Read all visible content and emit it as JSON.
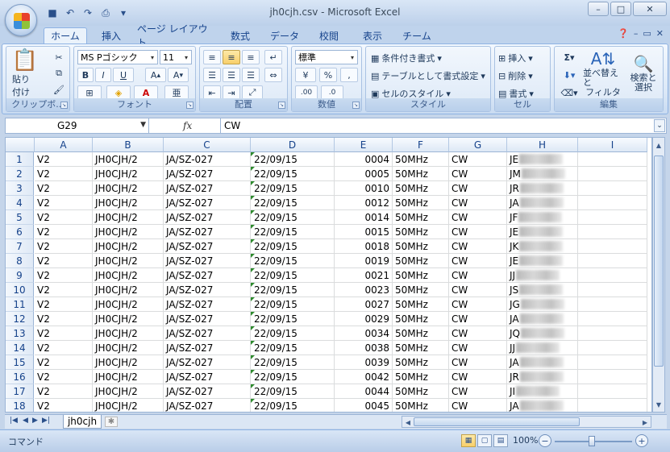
{
  "window": {
    "title": "jh0cjh.csv - Microsoft Excel"
  },
  "tabs": [
    "ホーム",
    "挿入",
    "ページ レイアウト",
    "数式",
    "データ",
    "校閲",
    "表示",
    "チーム"
  ],
  "ribbon": {
    "clipboard": {
      "label": "クリップボ...",
      "paste": "貼り付け"
    },
    "font": {
      "label": "フォント",
      "name": "MS Pゴシック",
      "size": "11"
    },
    "alignment": {
      "label": "配置"
    },
    "number": {
      "label": "数値",
      "format": "標準"
    },
    "styles": {
      "label": "スタイル",
      "conditional": "条件付き書式",
      "table": "テーブルとして書式設定",
      "cell_styles": "セルのスタイル"
    },
    "cells": {
      "label": "セル",
      "insert": "挿入",
      "delete": "削除",
      "format": "書式"
    },
    "editing": {
      "label": "編集",
      "sort_filter_line1": "並べ替えと",
      "sort_filter_line2": "フィルタ",
      "find_line1": "検索と",
      "find_line2": "選択"
    }
  },
  "formula_bar": {
    "name_box": "G29",
    "value": "CW"
  },
  "columns": [
    "A",
    "B",
    "C",
    "D",
    "E",
    "F",
    "G",
    "H",
    "I"
  ],
  "rows": [
    {
      "n": "1",
      "a": "V2",
      "b": "JH0CJH/2",
      "c": "JA/SZ-027",
      "d": "22/09/15",
      "e": "0004",
      "f": "50MHz",
      "g": "CW",
      "h": "JE"
    },
    {
      "n": "2",
      "a": "V2",
      "b": "JH0CJH/2",
      "c": "JA/SZ-027",
      "d": "22/09/15",
      "e": "0005",
      "f": "50MHz",
      "g": "CW",
      "h": "JM"
    },
    {
      "n": "3",
      "a": "V2",
      "b": "JH0CJH/2",
      "c": "JA/SZ-027",
      "d": "22/09/15",
      "e": "0010",
      "f": "50MHz",
      "g": "CW",
      "h": "JR"
    },
    {
      "n": "4",
      "a": "V2",
      "b": "JH0CJH/2",
      "c": "JA/SZ-027",
      "d": "22/09/15",
      "e": "0012",
      "f": "50MHz",
      "g": "CW",
      "h": "JA"
    },
    {
      "n": "5",
      "a": "V2",
      "b": "JH0CJH/2",
      "c": "JA/SZ-027",
      "d": "22/09/15",
      "e": "0014",
      "f": "50MHz",
      "g": "CW",
      "h": "JF"
    },
    {
      "n": "6",
      "a": "V2",
      "b": "JH0CJH/2",
      "c": "JA/SZ-027",
      "d": "22/09/15",
      "e": "0015",
      "f": "50MHz",
      "g": "CW",
      "h": "JE"
    },
    {
      "n": "7",
      "a": "V2",
      "b": "JH0CJH/2",
      "c": "JA/SZ-027",
      "d": "22/09/15",
      "e": "0018",
      "f": "50MHz",
      "g": "CW",
      "h": "JK"
    },
    {
      "n": "8",
      "a": "V2",
      "b": "JH0CJH/2",
      "c": "JA/SZ-027",
      "d": "22/09/15",
      "e": "0019",
      "f": "50MHz",
      "g": "CW",
      "h": "JE"
    },
    {
      "n": "9",
      "a": "V2",
      "b": "JH0CJH/2",
      "c": "JA/SZ-027",
      "d": "22/09/15",
      "e": "0021",
      "f": "50MHz",
      "g": "CW",
      "h": "JJ"
    },
    {
      "n": "10",
      "a": "V2",
      "b": "JH0CJH/2",
      "c": "JA/SZ-027",
      "d": "22/09/15",
      "e": "0023",
      "f": "50MHz",
      "g": "CW",
      "h": "JS"
    },
    {
      "n": "11",
      "a": "V2",
      "b": "JH0CJH/2",
      "c": "JA/SZ-027",
      "d": "22/09/15",
      "e": "0027",
      "f": "50MHz",
      "g": "CW",
      "h": "JG"
    },
    {
      "n": "12",
      "a": "V2",
      "b": "JH0CJH/2",
      "c": "JA/SZ-027",
      "d": "22/09/15",
      "e": "0029",
      "f": "50MHz",
      "g": "CW",
      "h": "JA"
    },
    {
      "n": "13",
      "a": "V2",
      "b": "JH0CJH/2",
      "c": "JA/SZ-027",
      "d": "22/09/15",
      "e": "0034",
      "f": "50MHz",
      "g": "CW",
      "h": "JQ"
    },
    {
      "n": "14",
      "a": "V2",
      "b": "JH0CJH/2",
      "c": "JA/SZ-027",
      "d": "22/09/15",
      "e": "0038",
      "f": "50MHz",
      "g": "CW",
      "h": "JJ"
    },
    {
      "n": "15",
      "a": "V2",
      "b": "JH0CJH/2",
      "c": "JA/SZ-027",
      "d": "22/09/15",
      "e": "0039",
      "f": "50MHz",
      "g": "CW",
      "h": "JA"
    },
    {
      "n": "16",
      "a": "V2",
      "b": "JH0CJH/2",
      "c": "JA/SZ-027",
      "d": "22/09/15",
      "e": "0042",
      "f": "50MHz",
      "g": "CW",
      "h": "JR"
    },
    {
      "n": "17",
      "a": "V2",
      "b": "JH0CJH/2",
      "c": "JA/SZ-027",
      "d": "22/09/15",
      "e": "0044",
      "f": "50MHz",
      "g": "CW",
      "h": "JI"
    },
    {
      "n": "18",
      "a": "V2",
      "b": "JH0CJH/2",
      "c": "JA/SZ-027",
      "d": "22/09/15",
      "e": "0045",
      "f": "50MHz",
      "g": "CW",
      "h": "JA"
    }
  ],
  "sheet_tab": "jh0cjh",
  "status": {
    "mode": "コマンド",
    "zoom": "100%"
  },
  "icons": [
    "office-button-icon",
    "save-icon",
    "undo-icon",
    "redo-icon",
    "print-icon",
    "help-icon",
    "paste-icon",
    "cut-icon",
    "copy-icon",
    "format-painter-icon",
    "bold-icon",
    "italic-icon",
    "underline-icon",
    "fill-color-icon",
    "font-color-icon",
    "sum-icon",
    "fill-icon",
    "clear-icon",
    "sort-filter-icon",
    "find-select-icon",
    "fx-icon",
    "new-sheet-icon",
    "zoom-in-icon",
    "zoom-out-icon"
  ]
}
